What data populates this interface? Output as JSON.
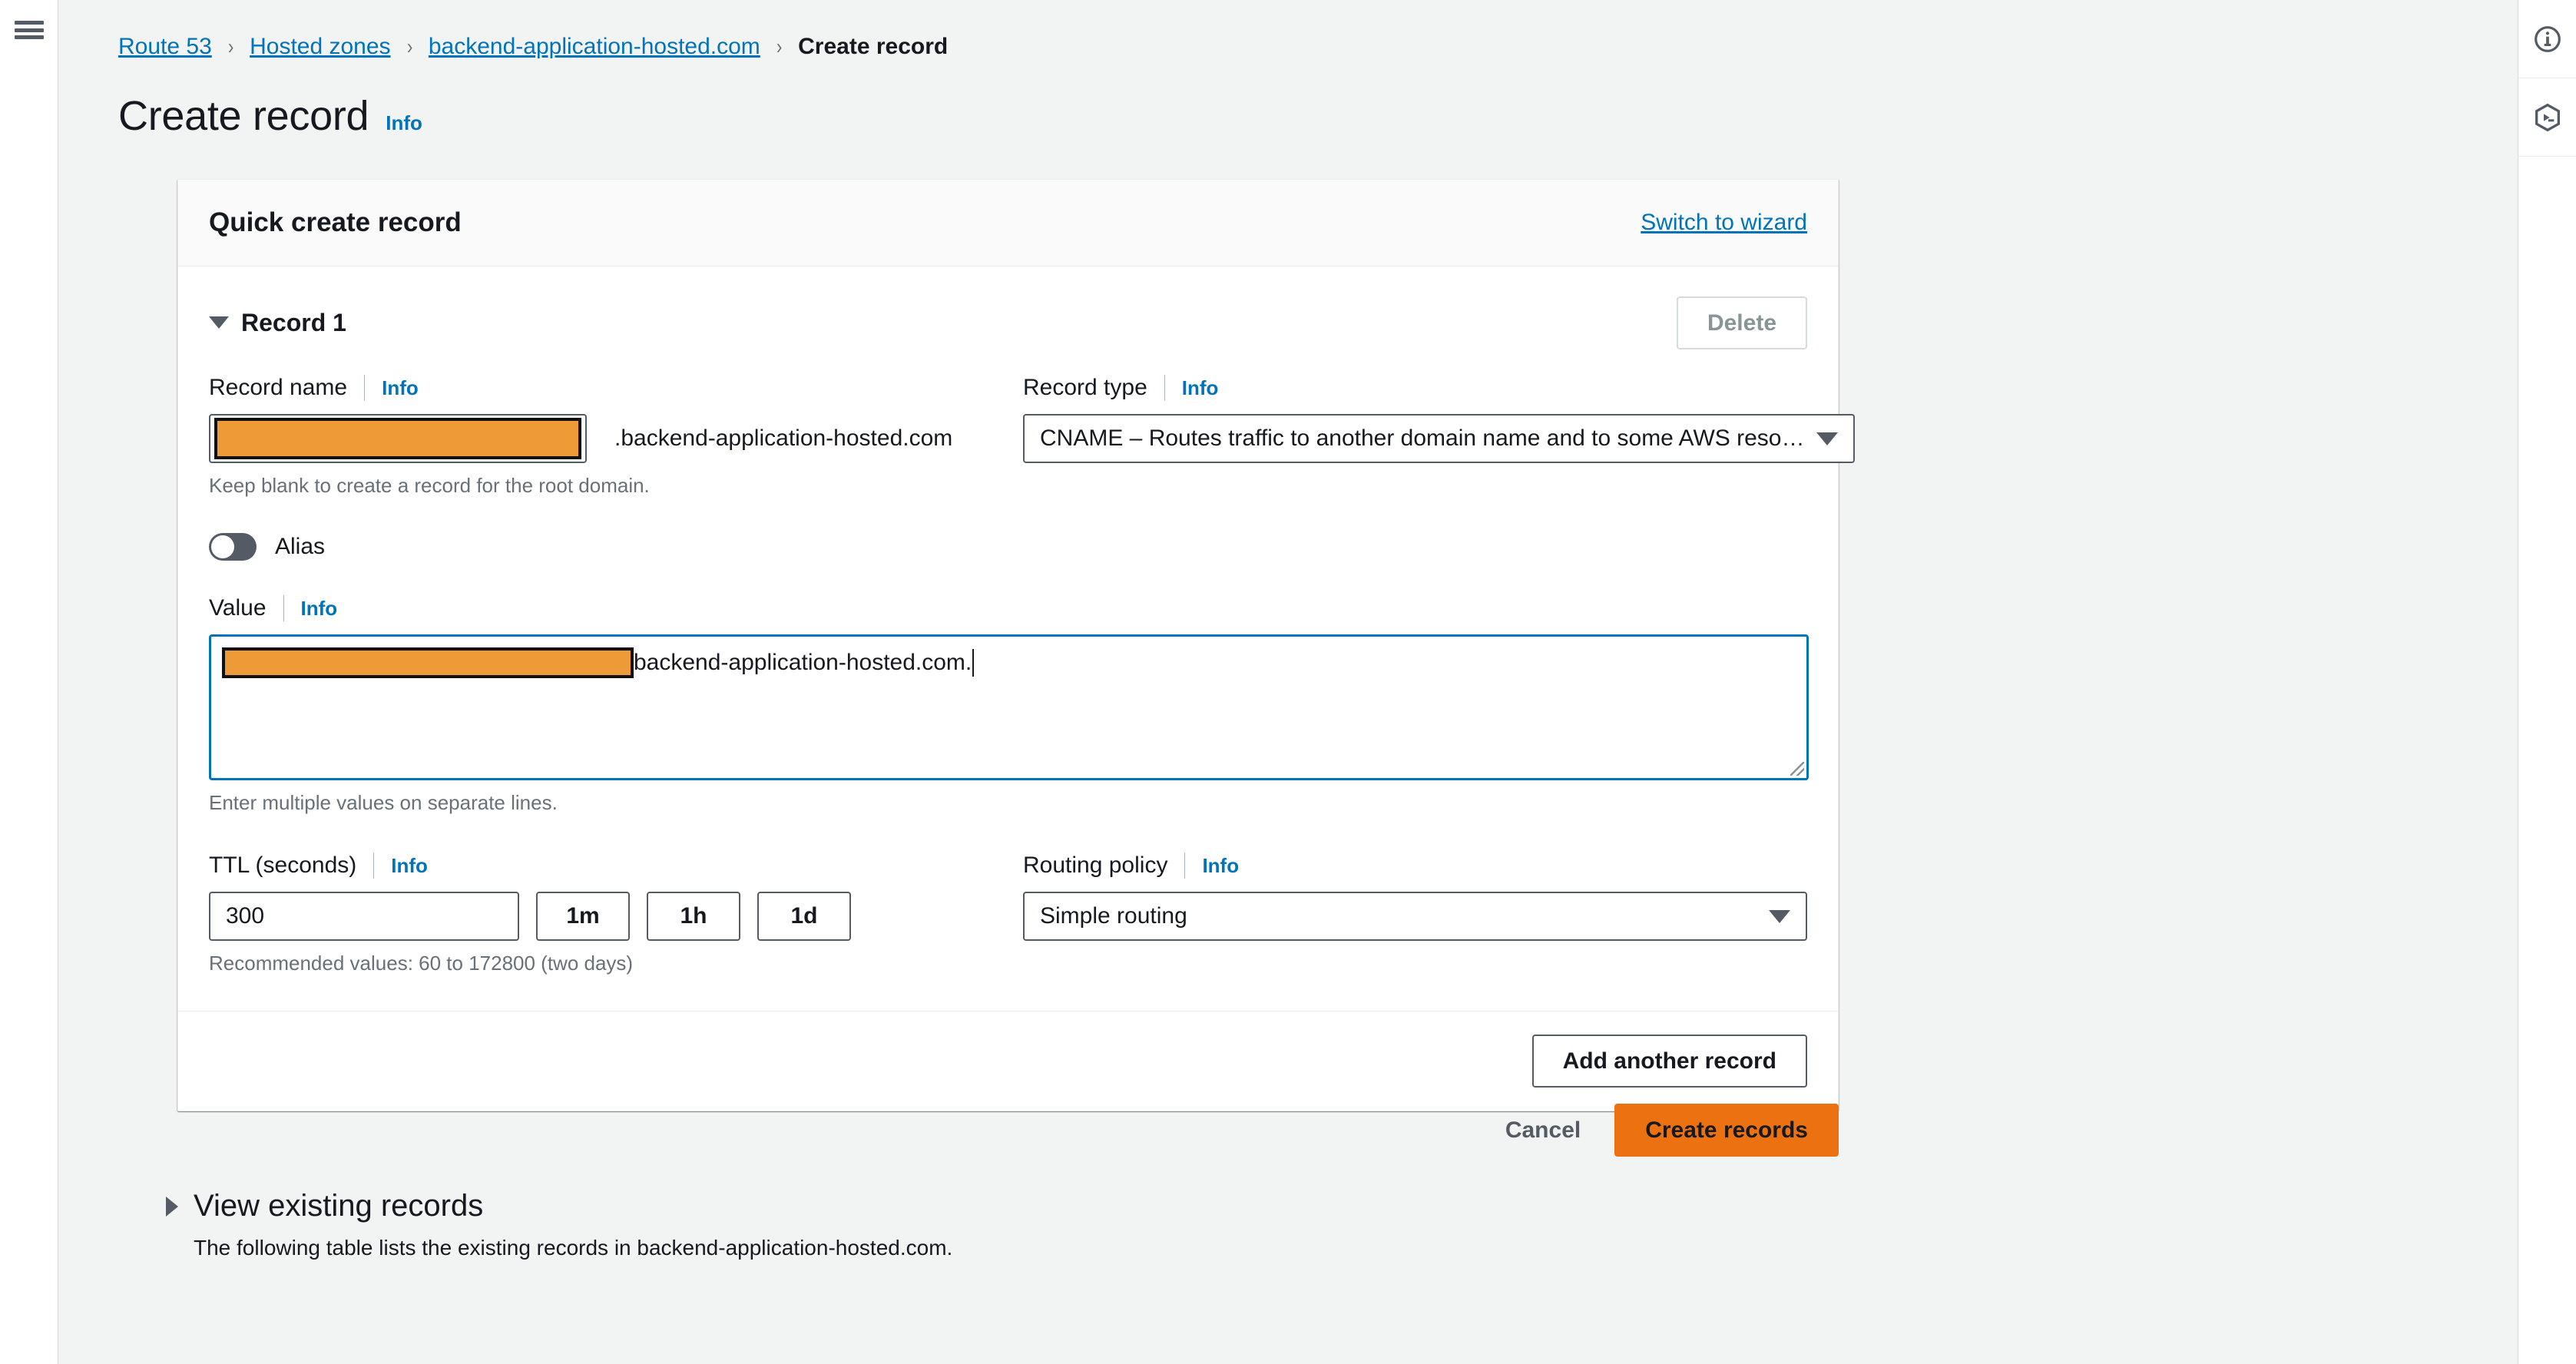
{
  "breadcrumb": {
    "items": [
      {
        "label": "Route 53",
        "type": "link"
      },
      {
        "label": "Hosted zones",
        "type": "link"
      },
      {
        "label": "backend-application-hosted.com",
        "type": "link"
      },
      {
        "label": "Create record",
        "type": "current"
      }
    ],
    "separator": "›"
  },
  "page": {
    "title": "Create record",
    "info_label": "Info"
  },
  "card": {
    "header_title": "Quick create record",
    "switch_link": "Switch to wizard",
    "record_title": "Record 1",
    "delete_label": "Delete",
    "add_another_label": "Add another record"
  },
  "record_name": {
    "label": "Record name",
    "info_label": "Info",
    "value": "",
    "redacted": true,
    "suffix": ".backend-application-hosted.com",
    "hint": "Keep blank to create a record for the root domain."
  },
  "record_type": {
    "label": "Record type",
    "info_label": "Info",
    "selected": "CNAME – Routes traffic to another domain name and to some AWS reso…"
  },
  "alias": {
    "label": "Alias",
    "enabled": false
  },
  "value_field": {
    "label": "Value",
    "info_label": "Info",
    "redacted_prefix": true,
    "text": "backend-application-hosted.com.",
    "hint": "Enter multiple values on separate lines.",
    "focused": true
  },
  "ttl": {
    "label": "TTL (seconds)",
    "info_label": "Info",
    "value": "300",
    "presets": [
      "1m",
      "1h",
      "1d"
    ],
    "hint": "Recommended values: 60 to 172800 (two days)"
  },
  "routing_policy": {
    "label": "Routing policy",
    "info_label": "Info",
    "selected": "Simple routing"
  },
  "actions": {
    "cancel_label": "Cancel",
    "create_label": "Create records"
  },
  "existing_records": {
    "title": "View existing records",
    "description": "The following table lists the existing records in backend-application-hosted.com.",
    "expanded": false
  },
  "right_rail": {
    "info_icon": "info-circle-icon",
    "cloudshell_icon": "cloudshell-hexagon-icon"
  },
  "colors": {
    "accent_orange": "#ec7211",
    "redaction_orange": "#ed9b36",
    "link_blue": "#0073bb",
    "focus_blue": "#0073bb",
    "page_bg": "#f2f3f3"
  }
}
